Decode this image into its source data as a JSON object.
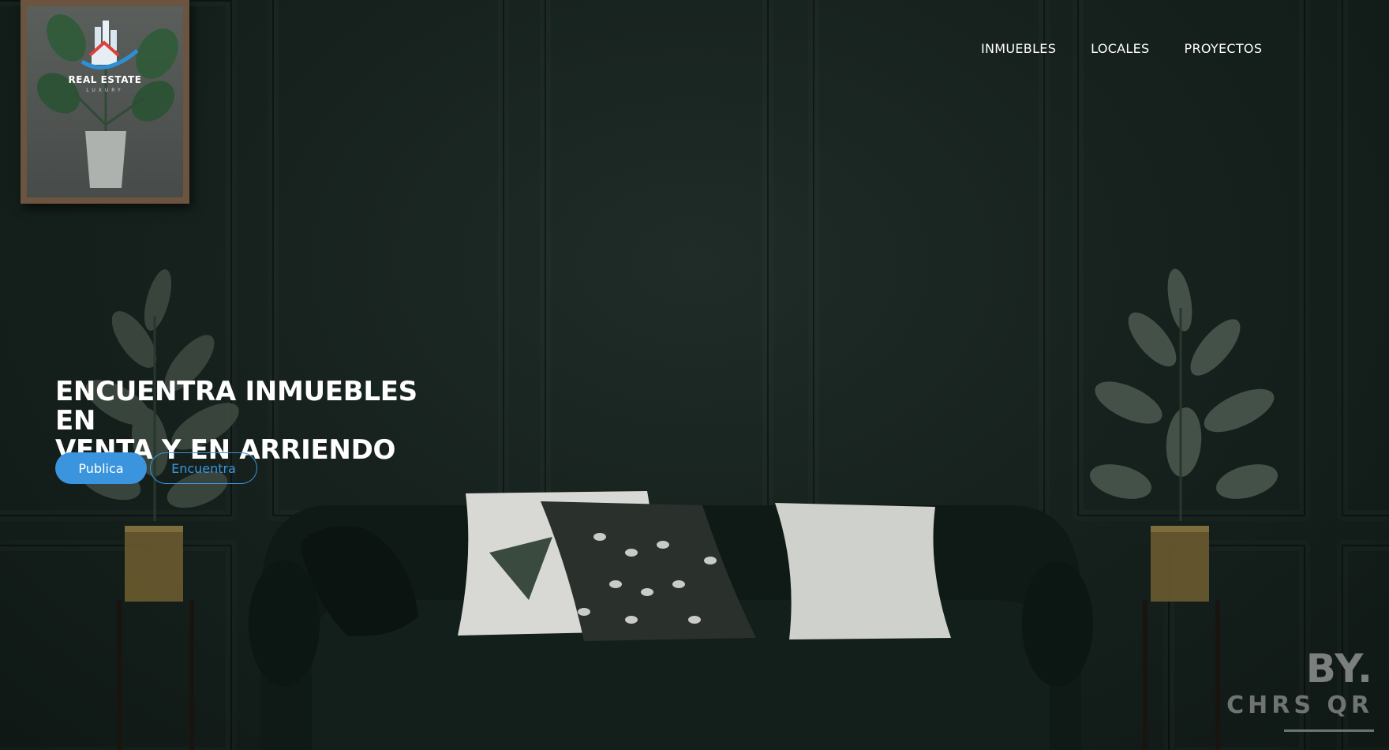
{
  "logo": {
    "title": "REAL ESTATE",
    "subtitle": "LUXURY",
    "icon": "house-city-logo-icon"
  },
  "nav": {
    "items": [
      {
        "label": "INMUEBLES"
      },
      {
        "label": "LOCALES"
      },
      {
        "label": "PROYECTOS"
      }
    ]
  },
  "hero": {
    "title_line1": "ENCUENTRA INMUEBLES EN",
    "title_line2": "VENTA Y EN ARRIENDO",
    "primary_button": "Publica",
    "secondary_button": "Encuentra"
  },
  "watermark": {
    "line1": "BY.",
    "line2": "CHRS QR"
  },
  "colors": {
    "accent": "#3a95de",
    "background": "#17221e",
    "text": "#ffffff"
  }
}
